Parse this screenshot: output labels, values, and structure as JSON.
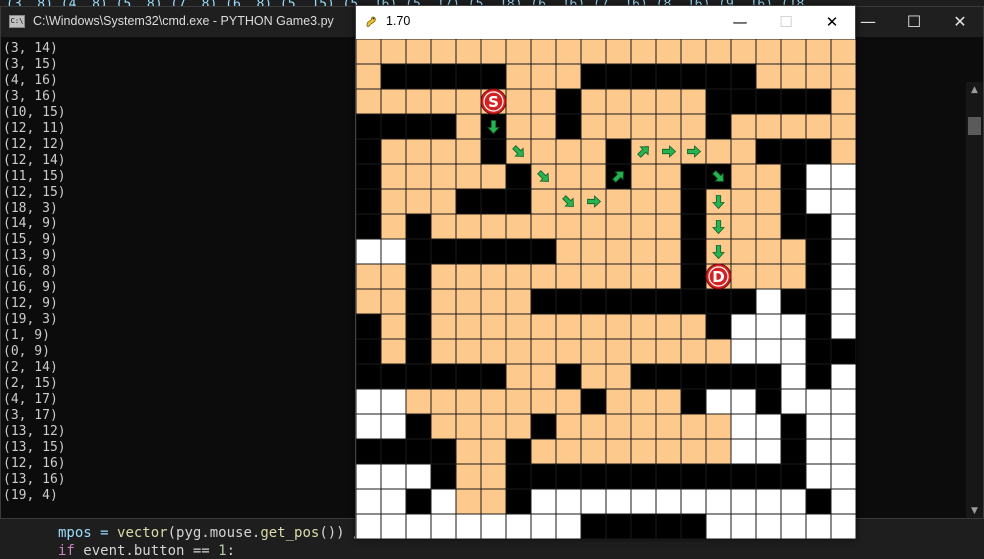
{
  "background_editor": {
    "top_fragment": "(3, 8)  (4, 8)  (5, 8)  (7, 8)  (6, 8)  (5, 15)  (5, 16)  (5, 17)  (5, 18)  (6, 16)  (7, 16)  (8, 16)  (9, 16)  (18",
    "code_line_1_prefix": "mpos = ",
    "code_line_1_fn": "vector",
    "code_line_1_rest": "(pyg.mouse.",
    "code_line_1_fn2": "get_pos",
    "code_line_1_tail": "()) /",
    "code_line_2_kw": "if",
    "code_line_2_rest": " event.button == ",
    "code_line_2_num": "1",
    "code_line_2_tail": ":"
  },
  "cmd_window": {
    "icon_label": "C:\\",
    "title": "C:\\Windows\\System32\\cmd.exe - PYTHON  Game3.py",
    "minimize": "—",
    "maximize": "☐",
    "close": "✕",
    "output_lines": [
      "(3, 14)",
      "(3, 15)",
      "(4, 16)",
      "(3, 16)",
      "(10, 15)",
      "(12, 11)",
      "(12, 12)",
      "(12, 14)",
      "(11, 15)",
      "(12, 15)",
      "(18, 3)",
      "(14, 9)",
      "(15, 9)",
      "(13, 9)",
      "(16, 8)",
      "(16, 9)",
      "(12, 9)",
      "(19, 3)",
      "(1, 9)",
      "(0, 9)",
      "(2, 14)",
      "(2, 15)",
      "(4, 17)",
      "(3, 17)",
      "(13, 12)",
      "(13, 15)",
      "(12, 16)",
      "(13, 16)",
      "(19, 4)"
    ]
  },
  "pygame_window": {
    "title": "1.70",
    "minimize": "—",
    "maximize": "☐",
    "close": "✕",
    "start_label": "S",
    "dest_label": "D",
    "colors": {
      "wall": "#000000",
      "visited": "#fdc98c",
      "open": "#ffffff",
      "gridline": "#1a1a1a",
      "marker": "#d42222",
      "arrow": "#27b34f"
    },
    "maze_rows": [
      "OOOOOOOOOOOOOOOOOOOO",
      "OWWWWWOOOWWWWWWWOOOO",
      "OOOOOOOOWOOOOOWWWWWO",
      "WWWWOWOOWOOOOOWOOOOO",
      "WOOOOWOOOOWOOOOOWWWO",
      "WOOOOOWOOOWOOWWOOWAA",
      "WOOOWWWOOOOOOWOOOWAA",
      "WOWOOOOOOOOOOWOOOWWA",
      "AAWWWWWWOOOOOWOOOOWA",
      "OOWOOOOOOOOOOWOOOOWA",
      "OOWOOOOWWWWWWWWWAWWA",
      "WOWOOOOOOOOOOOWAAAWA",
      "WOWOOOOOOOOOOOOAAAWW",
      "WWWWWWOOWOOWWWWWWAWA",
      "AAOOOOOOOWOOOWAAWAAA",
      "AAWOOOOWOOOOOOOAAWAA",
      "WWWWOOWOOOOOOOOAAWAA",
      "AAAWOOWWWWWWWWWWWWAA",
      "AAWAOOWAAAAAAAAAAAWA",
      "AAAAAAAAAWWWWWAAAAAA"
    ],
    "start_cell": {
      "col": 5,
      "row": 2
    },
    "dest_cell": {
      "col": 14,
      "row": 9
    },
    "arrows": [
      {
        "col": 5,
        "row": 3,
        "dir": "S"
      },
      {
        "col": 6,
        "row": 4,
        "dir": "SE"
      },
      {
        "col": 7,
        "row": 5,
        "dir": "SE"
      },
      {
        "col": 8,
        "row": 6,
        "dir": "SE"
      },
      {
        "col": 9,
        "row": 6,
        "dir": "E"
      },
      {
        "col": 10,
        "row": 5,
        "dir": "NE"
      },
      {
        "col": 11,
        "row": 4,
        "dir": "NE"
      },
      {
        "col": 12,
        "row": 4,
        "dir": "E"
      },
      {
        "col": 13,
        "row": 4,
        "dir": "E"
      },
      {
        "col": 14,
        "row": 5,
        "dir": "SE"
      },
      {
        "col": 14,
        "row": 6,
        "dir": "S"
      },
      {
        "col": 14,
        "row": 7,
        "dir": "S"
      },
      {
        "col": 14,
        "row": 8,
        "dir": "S"
      }
    ]
  }
}
